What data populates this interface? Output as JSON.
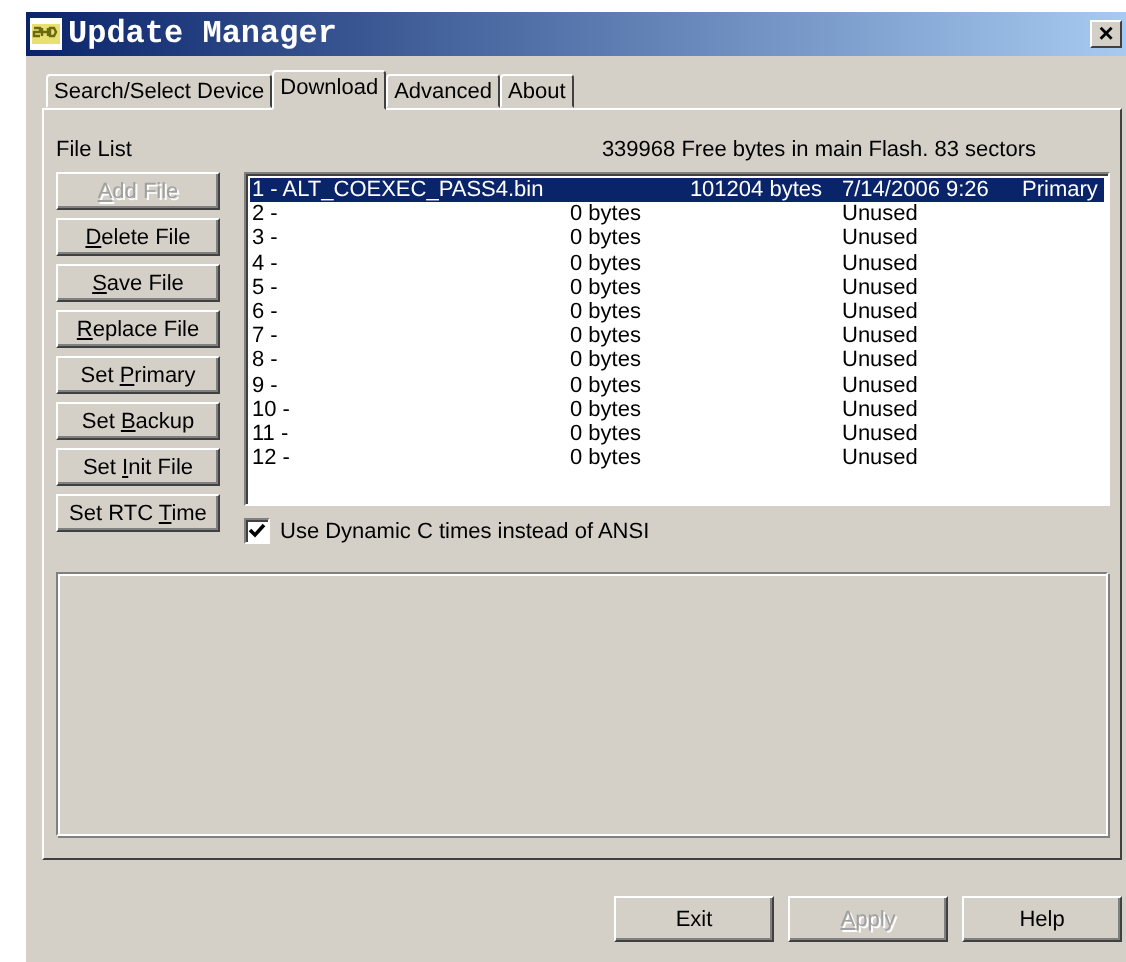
{
  "window": {
    "title": "Update Manager",
    "close": "×"
  },
  "tabs": [
    {
      "label": "Search/Select Device",
      "selected": false
    },
    {
      "label": "Download",
      "selected": true
    },
    {
      "label": "Advanced",
      "selected": false
    },
    {
      "label": "About",
      "selected": false
    }
  ],
  "file_list_label": "File List",
  "flash_info": "339968 Free bytes in main Flash. 83 sectors",
  "side_buttons": [
    {
      "key": "A",
      "after": "dd File",
      "disabled": true
    },
    {
      "key": "D",
      "after": "elete File",
      "disabled": false
    },
    {
      "key": "S",
      "after": "ave File",
      "disabled": false
    },
    {
      "key": "R",
      "after": "eplace File",
      "disabled": false
    },
    {
      "before": "Set ",
      "key": "P",
      "after": "rimary",
      "disabled": false
    },
    {
      "before": "Set ",
      "key": "B",
      "after": "ackup",
      "disabled": false
    },
    {
      "before": "Set ",
      "key": "I",
      "after": "nit File",
      "disabled": false
    },
    {
      "before": "Set RTC ",
      "key": "T",
      "after": "ime",
      "disabled": false
    }
  ],
  "files": [
    {
      "name": "1 - ALT_COEXEC_PASS4.bin",
      "size": "101204 bytes",
      "date": "7/14/2006 9:26",
      "status": "Primary",
      "selected": true
    },
    {
      "name": "2 -",
      "size": "0 bytes",
      "status": "Unused",
      "selected": false
    },
    {
      "name": "3 -",
      "size": "0 bytes",
      "status": "Unused",
      "selected": false
    },
    {
      "name": "4 -",
      "size": "0 bytes",
      "status": "Unused",
      "selected": false
    },
    {
      "name": "5 -",
      "size": "0 bytes",
      "status": "Unused",
      "selected": false
    },
    {
      "name": "6 -",
      "size": "0 bytes",
      "status": "Unused",
      "selected": false
    },
    {
      "name": "7 -",
      "size": "0 bytes",
      "status": "Unused",
      "selected": false
    },
    {
      "name": "8 -",
      "size": "0 bytes",
      "status": "Unused",
      "selected": false
    },
    {
      "name": "9 -",
      "size": "0 bytes",
      "status": "Unused",
      "selected": false
    },
    {
      "name": "10 -",
      "size": "0 bytes",
      "status": "Unused",
      "selected": false
    },
    {
      "name": "11 -",
      "size": "0 bytes",
      "status": "Unused",
      "selected": false
    },
    {
      "name": "12 -",
      "size": "0 bytes",
      "status": "Unused",
      "selected": false
    }
  ],
  "dynamic_c_times": {
    "label": "Use Dynamic C times instead of ANSI",
    "checked": true
  },
  "bottom_buttons": [
    {
      "before": "Exit",
      "disabled": false
    },
    {
      "key": "A",
      "after": "pply",
      "disabled": true
    },
    {
      "before": "Help",
      "disabled": false
    }
  ]
}
